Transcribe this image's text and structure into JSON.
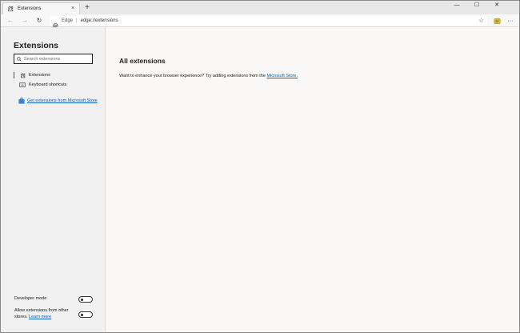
{
  "tab": {
    "title": "Extensions",
    "close_glyph": "×",
    "icon": "extensions-puzzle-icon"
  },
  "tabstrip": {
    "new_tab_glyph": "+"
  },
  "window_controls": {
    "minimize": "—",
    "maximize": "☐",
    "close": "✕"
  },
  "toolbar": {
    "back_glyph": "←",
    "forward_glyph": "→",
    "refresh_glyph": "↻",
    "brand": "Edge",
    "separator": "|",
    "url": "edge://extensions",
    "favorite_glyph": "☆",
    "more_glyph": "···"
  },
  "sidebar": {
    "title": "Extensions",
    "search_placeholder": "Search extensions",
    "items": [
      {
        "label": "Extensions",
        "icon": "puzzle-icon",
        "selected": true
      },
      {
        "label": "Keyboard shortcuts",
        "icon": "keyboard-icon",
        "selected": false
      }
    ],
    "store_link": "Get extensions from Microsoft Store",
    "developer_mode": {
      "label": "Developer mode",
      "enabled": false
    },
    "allow_other_stores": {
      "label": "Allow extensions from other stores.",
      "learn_more": "Learn more",
      "enabled": false
    }
  },
  "main": {
    "title": "All extensions",
    "description_prefix": "Want to enhance your browser experience? Try adding extensions from the",
    "store_link": "Microsoft Store."
  },
  "colors": {
    "accent": "#0a5fb4",
    "sidebar_bg": "#f1f1f1",
    "main_bg": "#f9f8f7"
  }
}
